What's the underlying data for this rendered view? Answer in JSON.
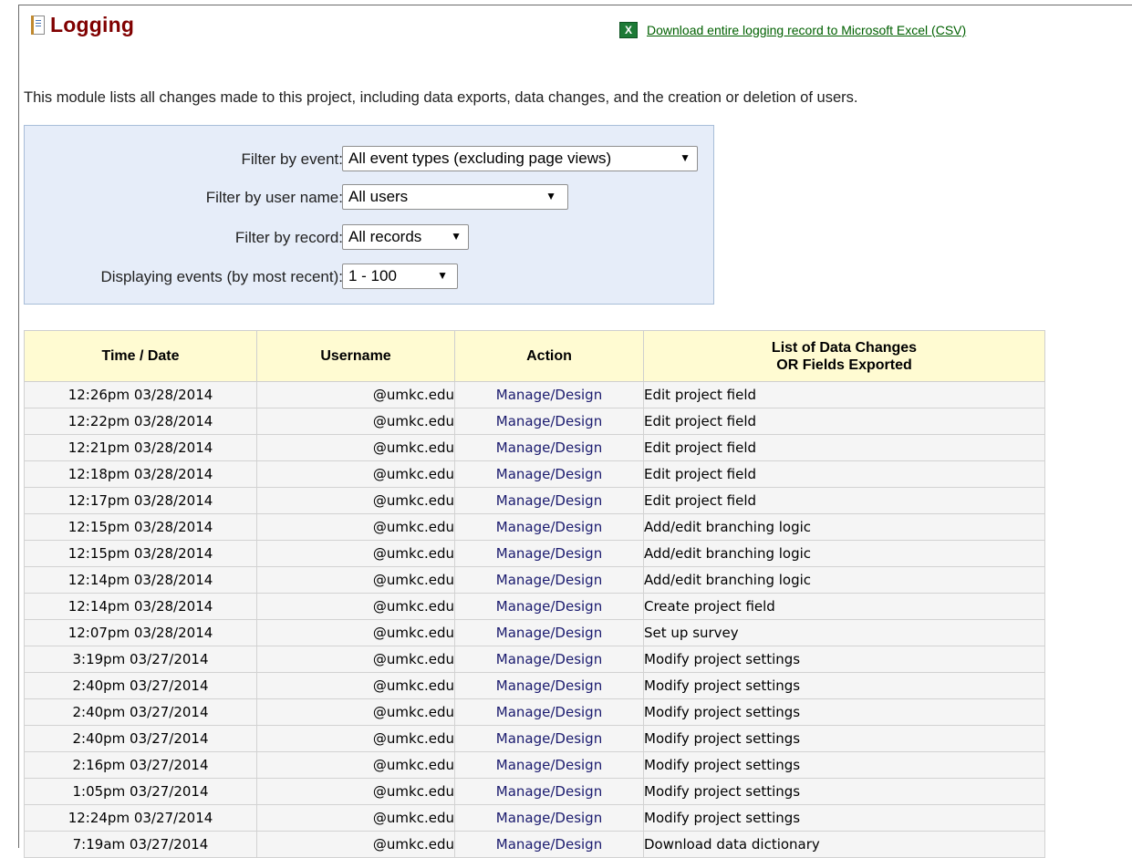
{
  "page": {
    "title": "Logging",
    "title_icon": "log-book-icon",
    "download_link": "Download entire logging record to Microsoft Excel (CSV)",
    "download_icon": "excel-icon",
    "intro": "This module lists all changes made to this project, including data exports, data changes, and the creation or deletion of users."
  },
  "filters": {
    "event": {
      "label": "Filter by event:",
      "value": "All event types (excluding page views)"
    },
    "user": {
      "label": "Filter by user name:",
      "value": "All users"
    },
    "record": {
      "label": "Filter by record:",
      "value": "All records"
    },
    "range": {
      "label": "Displaying events (by most recent):",
      "value": "1 - 100"
    }
  },
  "table": {
    "headers": {
      "time": "Time / Date",
      "user": "Username",
      "action": "Action",
      "changes_line1": "List of Data Changes",
      "changes_line2": "OR Fields Exported"
    },
    "rows": [
      {
        "time": "12:26pm 03/28/2014",
        "user": "@umkc.edu",
        "action": "Manage/Design",
        "desc": "Edit project field"
      },
      {
        "time": "12:22pm 03/28/2014",
        "user": "@umkc.edu",
        "action": "Manage/Design",
        "desc": "Edit project field"
      },
      {
        "time": "12:21pm 03/28/2014",
        "user": "@umkc.edu",
        "action": "Manage/Design",
        "desc": "Edit project field"
      },
      {
        "time": "12:18pm 03/28/2014",
        "user": "@umkc.edu",
        "action": "Manage/Design",
        "desc": "Edit project field"
      },
      {
        "time": "12:17pm 03/28/2014",
        "user": "@umkc.edu",
        "action": "Manage/Design",
        "desc": "Edit project field"
      },
      {
        "time": "12:15pm 03/28/2014",
        "user": "@umkc.edu",
        "action": "Manage/Design",
        "desc": "Add/edit branching logic"
      },
      {
        "time": "12:15pm 03/28/2014",
        "user": "@umkc.edu",
        "action": "Manage/Design",
        "desc": "Add/edit branching logic"
      },
      {
        "time": "12:14pm 03/28/2014",
        "user": "@umkc.edu",
        "action": "Manage/Design",
        "desc": "Add/edit branching logic"
      },
      {
        "time": "12:14pm 03/28/2014",
        "user": "@umkc.edu",
        "action": "Manage/Design",
        "desc": "Create project field"
      },
      {
        "time": "12:07pm 03/28/2014",
        "user": "@umkc.edu",
        "action": "Manage/Design",
        "desc": "Set up survey"
      },
      {
        "time": "3:19pm 03/27/2014",
        "user": "@umkc.edu",
        "action": "Manage/Design",
        "desc": "Modify project settings"
      },
      {
        "time": "2:40pm 03/27/2014",
        "user": "@umkc.edu",
        "action": "Manage/Design",
        "desc": "Modify project settings"
      },
      {
        "time": "2:40pm 03/27/2014",
        "user": "@umkc.edu",
        "action": "Manage/Design",
        "desc": "Modify project settings"
      },
      {
        "time": "2:40pm 03/27/2014",
        "user": "@umkc.edu",
        "action": "Manage/Design",
        "desc": "Modify project settings"
      },
      {
        "time": "2:16pm 03/27/2014",
        "user": "@umkc.edu",
        "action": "Manage/Design",
        "desc": "Modify project settings"
      },
      {
        "time": "1:05pm 03/27/2014",
        "user": "@umkc.edu",
        "action": "Manage/Design",
        "desc": "Modify project settings"
      },
      {
        "time": "12:24pm 03/27/2014",
        "user": "@umkc.edu",
        "action": "Manage/Design",
        "desc": "Modify project settings"
      },
      {
        "time": "7:19am 03/27/2014",
        "user": "@umkc.edu",
        "action": "Manage/Design",
        "desc": "Download data dictionary"
      }
    ]
  },
  "colors": {
    "title": "#800000",
    "link": "#006000",
    "filter_bg": "#e6edf9",
    "header_bg": "#fffbd2",
    "action_text": "#1a1a6e"
  }
}
